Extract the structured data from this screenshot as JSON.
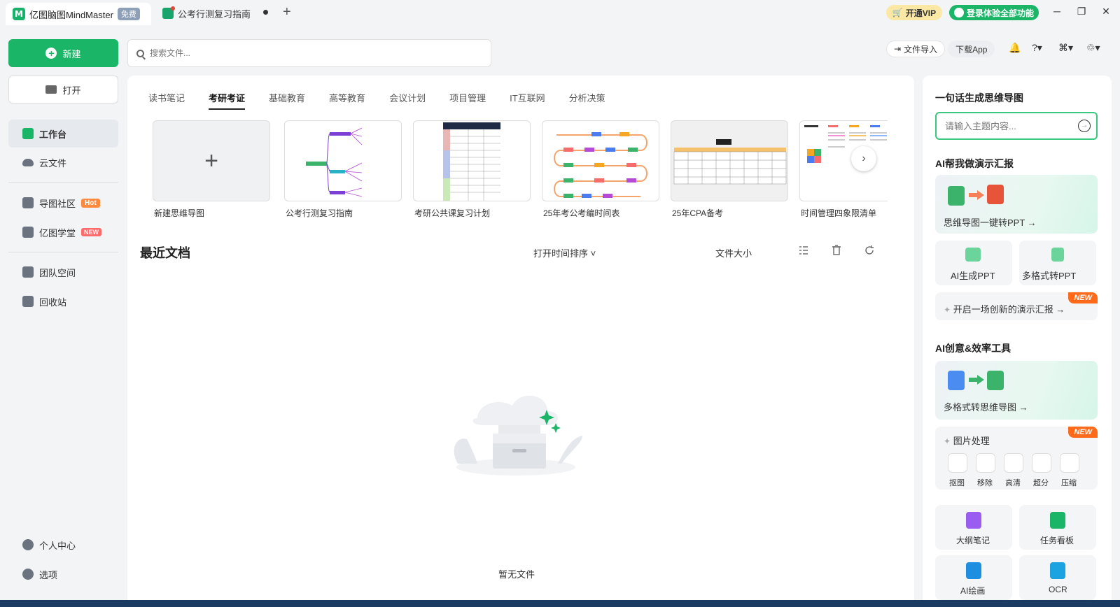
{
  "titlebar": {
    "app_name": "亿图脑图MindMaster",
    "free_badge": "免费",
    "doc_tab": "公考行测复习指南",
    "vip": "开通VIP",
    "login": "登录体验全部功能"
  },
  "sidebar": {
    "new": "新建",
    "open": "打开",
    "items": [
      {
        "label": "工作台"
      },
      {
        "label": "云文件"
      },
      {
        "label": "导图社区",
        "badge": "Hot"
      },
      {
        "label": "亿图学堂",
        "badge": "NEW"
      },
      {
        "label": "团队空间"
      },
      {
        "label": "回收站"
      },
      {
        "label": "个人中心"
      },
      {
        "label": "选项"
      }
    ]
  },
  "search": {
    "placeholder": "搜索文件..."
  },
  "toolbar": {
    "import": "文件导入",
    "download": "下载App"
  },
  "categories": [
    "读书笔记",
    "考研考证",
    "基础教育",
    "高等教育",
    "会议计划",
    "项目管理",
    "IT互联网",
    "分析决策"
  ],
  "templates": [
    {
      "label": "新建思维导图"
    },
    {
      "label": "公考行测复习指南"
    },
    {
      "label": "考研公共课复习计划"
    },
    {
      "label": "25年考公考编时间表"
    },
    {
      "label": "25年CPA备考"
    },
    {
      "label": "时间管理四象限清单"
    }
  ],
  "recent": {
    "title": "最近文档",
    "sort": "打开时间排序",
    "size": "文件大小",
    "empty": "暂无文件"
  },
  "right": {
    "gen_title": "一句话生成思维导图",
    "gen_placeholder": "请输入主题内容...",
    "ppt_title": "AI帮我做演示汇报",
    "ppt_card": "思维导图一键转PPT →",
    "ai_ppt": "AI生成PPT",
    "multi_ppt": "多格式转PPT",
    "new_tag": "NEW",
    "start_show": "开启一场创新的演示汇报 →",
    "tools_title": "AI创意&效率工具",
    "multi_mind": "多格式转思维导图 →",
    "image_title": "图片处理",
    "image_tools": [
      "抠图",
      "移除",
      "高清",
      "超分",
      "压缩"
    ],
    "outline": "大纲笔记",
    "kanban": "任务看板",
    "ai_draw": "AI绘画",
    "ocr": "OCR"
  }
}
